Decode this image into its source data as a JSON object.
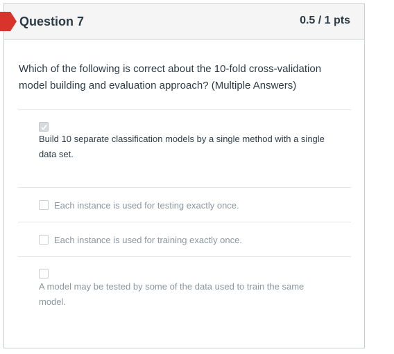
{
  "question": {
    "title": "Question 7",
    "points": "0.5 / 1 pts",
    "text": "Which of the following is correct about the 10-fold cross-validation model building and evaluation approach? (Multiple Answers)"
  },
  "answers": [
    {
      "label": "Build 10 separate classification models by a single method with a single data set.",
      "checked": true
    },
    {
      "label": "Each instance is used for testing exactly once.",
      "checked": false
    },
    {
      "label": "Each instance is used for training exactly once.",
      "checked": false
    },
    {
      "label": "A model may be tested by some of the data used to train the same model.",
      "checked": false
    }
  ],
  "colors": {
    "flag": "#d9342b",
    "header_bg": "#f5f5f5",
    "border": "#c7cdd1",
    "text": "#2d3b45",
    "muted_text": "#8b969e"
  },
  "icons": {
    "flag": "incorrect-flag-icon",
    "check": "checkmark-icon"
  }
}
